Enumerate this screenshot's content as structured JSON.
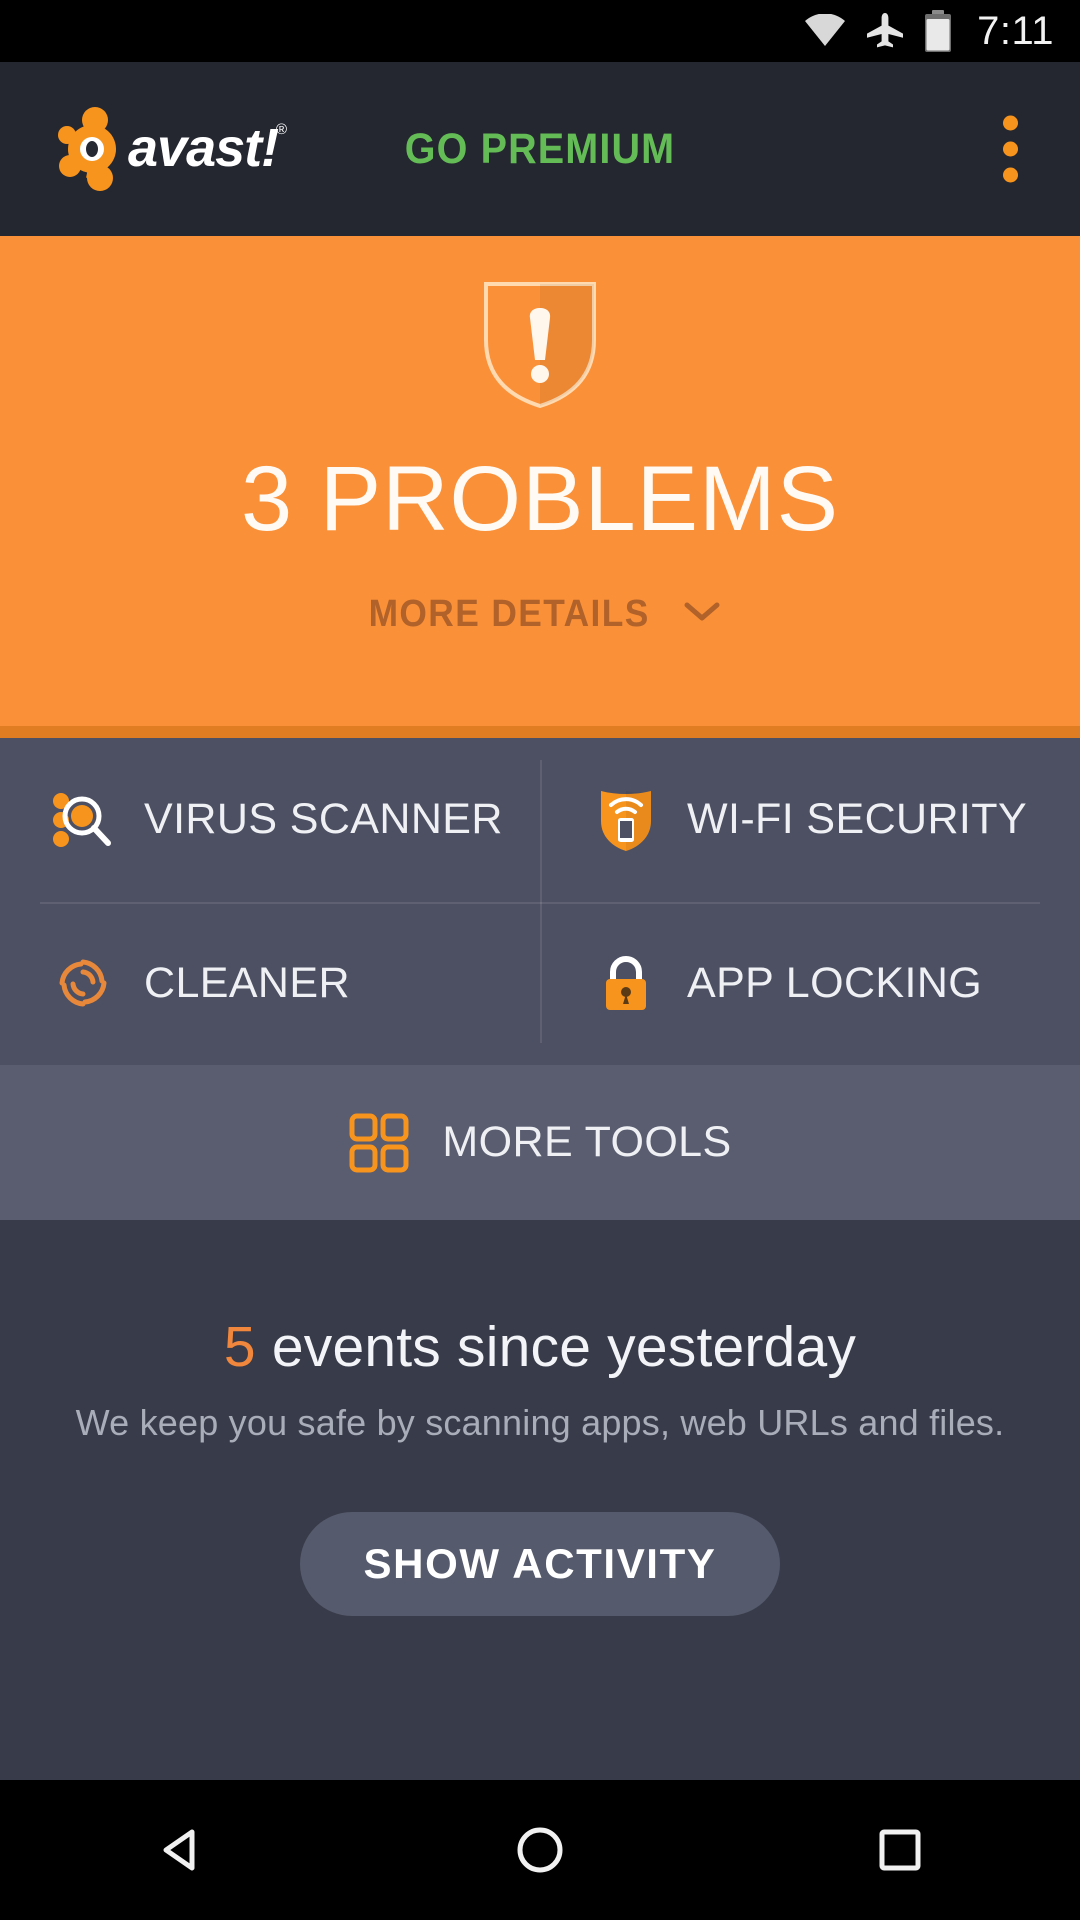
{
  "status_bar": {
    "time": "7:11",
    "icons": [
      {
        "name": "wifi-icon",
        "label": "wifi-full"
      },
      {
        "name": "airplane-mode-icon",
        "label": "airplane-mode"
      },
      {
        "name": "battery-icon",
        "label": "battery-full"
      }
    ]
  },
  "app_bar": {
    "brand": "avast!",
    "brand_trademark": "®",
    "go_premium_label": "GO PREMIUM",
    "overflow_label": "more-options"
  },
  "hero": {
    "status_icon": "shield-warning-icon",
    "title": "3 PROBLEMS",
    "more_details_label": "MORE DETAILS",
    "chevron": "chevron-down-icon"
  },
  "tools": [
    {
      "id": "virus-scanner",
      "label": "VIRUS SCANNER",
      "icon": "virus-scanner-icon"
    },
    {
      "id": "wifi-security",
      "label": "WI-FI SECURITY",
      "icon": "wifi-shield-icon"
    },
    {
      "id": "cleaner",
      "label": "CLEANER",
      "icon": "cleaner-swirl-icon"
    },
    {
      "id": "app-locking",
      "label": "APP LOCKING",
      "icon": "padlock-icon"
    }
  ],
  "more_tools": {
    "label": "MORE TOOLS",
    "icon": "grid-2x2-icon"
  },
  "activity": {
    "events_count": "5",
    "events_suffix": " events since yesterday",
    "subtitle": "We keep you safe by scanning apps, web URLs and files.",
    "button_label": "SHOW ACTIVITY"
  },
  "nav_bar": {
    "back": "back-triangle-icon",
    "home": "home-circle-icon",
    "recents": "recents-square-icon"
  },
  "colors": {
    "brand_orange": "#f7941e",
    "hero_orange": "#fa9038",
    "hero_divider": "#e07c22",
    "premium_green": "#63bc55",
    "app_bar_dark": "#242730",
    "tools_gray": "#4d5063",
    "more_tools_gray": "#5a5d70",
    "panel_dark": "#383b49"
  }
}
